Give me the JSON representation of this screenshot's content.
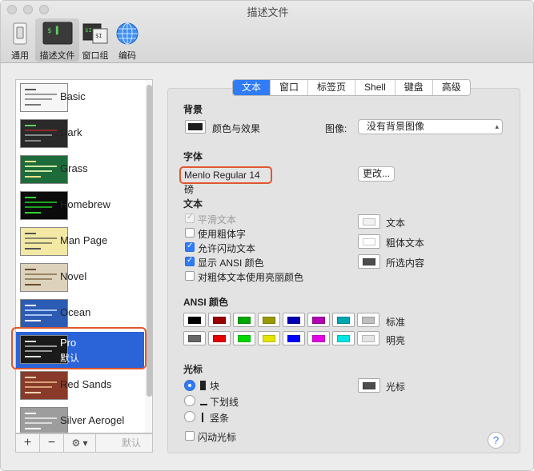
{
  "window": {
    "title": "描述文件"
  },
  "toolbar": {
    "items": [
      {
        "label": "通用",
        "icon": "switch-icon"
      },
      {
        "label": "描述文件",
        "icon": "terminal-profile-icon"
      },
      {
        "label": "窗口组",
        "icon": "window-groups-icon"
      },
      {
        "label": "编码",
        "icon": "globe-icon"
      }
    ]
  },
  "profiles": {
    "items": [
      {
        "name": "Basic"
      },
      {
        "name": "Dark"
      },
      {
        "name": "Grass"
      },
      {
        "name": "Homebrew"
      },
      {
        "name": "Man Page"
      },
      {
        "name": "Novel"
      },
      {
        "name": "Ocean"
      },
      {
        "name": "Pro",
        "default_label": "默认"
      },
      {
        "name": "Red Sands"
      },
      {
        "name": "Silver Aerogel"
      }
    ],
    "selected": "Pro",
    "buttons": {
      "add": "+",
      "remove": "−",
      "action": "⚙ ▾",
      "default": "默认"
    }
  },
  "tabs": [
    "文本",
    "窗口",
    "标签页",
    "Shell",
    "键盘",
    "高级"
  ],
  "background": {
    "heading": "背景",
    "color_effects": "颜色与效果",
    "image_label": "图像:",
    "image_value": "没有背景图像"
  },
  "font": {
    "heading": "字体",
    "value": "Menlo Regular 14 磅",
    "change_button": "更改..."
  },
  "text": {
    "heading": "文本",
    "options": [
      {
        "label": "平滑文本",
        "checked": true,
        "disabled": true
      },
      {
        "label": "使用粗体字",
        "checked": false,
        "disabled": false
      },
      {
        "label": "允许闪动文本",
        "checked": true,
        "disabled": false
      },
      {
        "label": "显示 ANSI 颜色",
        "checked": true,
        "disabled": false
      },
      {
        "label": "对粗体文本使用亮丽颜色",
        "checked": false,
        "disabled": false
      }
    ],
    "color_labels": [
      "文本",
      "粗体文本",
      "所选内容"
    ]
  },
  "ansi": {
    "heading": "ANSI 颜色",
    "normal_label": "标准",
    "bright_label": "明亮",
    "normal": [
      "#000000",
      "#990000",
      "#00a600",
      "#999900",
      "#0000b2",
      "#b200b2",
      "#00a6b2",
      "#bfbfbf"
    ],
    "bright": [
      "#666666",
      "#e50000",
      "#00d900",
      "#e5e500",
      "#0000ff",
      "#e500e5",
      "#00e5e5",
      "#e5e5e5"
    ]
  },
  "cursor": {
    "heading": "光标",
    "options": [
      "块",
      "下划线",
      "竖条"
    ],
    "selected": "块",
    "color_label": "光标",
    "blink_label": "闪动光标"
  },
  "help": "?"
}
